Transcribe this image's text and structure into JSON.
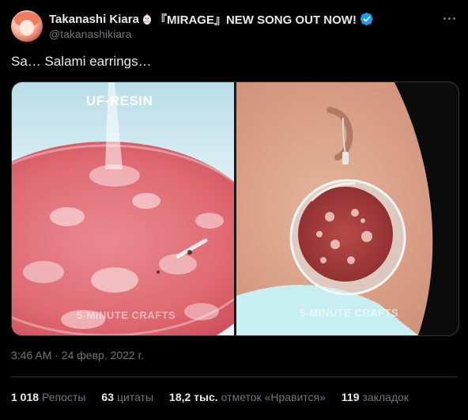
{
  "author": {
    "display_name": "Takanashi Kiara",
    "name_suffix": "『MIRAGE』NEW SONG OUT NOW!",
    "handle": "@takanashikiara",
    "verified": true,
    "name_glyph": "chicken-emoji",
    "verified_color": "#1d9bf0"
  },
  "tweet": {
    "text": "Sa… Salami earrings…",
    "timestamp": "3:46 AM · 24 февр. 2022 г."
  },
  "media": {
    "left_image": {
      "caption": "UF-RESIN",
      "watermark": "5-MINUTE CRAFTS"
    },
    "right_image": {
      "watermark": "5-MINUTE CRAFTS"
    }
  },
  "stats": [
    {
      "value": "1 018",
      "label": "Репосты"
    },
    {
      "value": "63",
      "label": "цитаты"
    },
    {
      "value": "18,2 тыс.",
      "label": "отметок «Нравится»"
    },
    {
      "value": "119",
      "label": "закладок"
    }
  ],
  "colors": {
    "background": "#000000",
    "text": "#e7e9ea",
    "muted": "#71767b",
    "border": "#2f3336"
  }
}
